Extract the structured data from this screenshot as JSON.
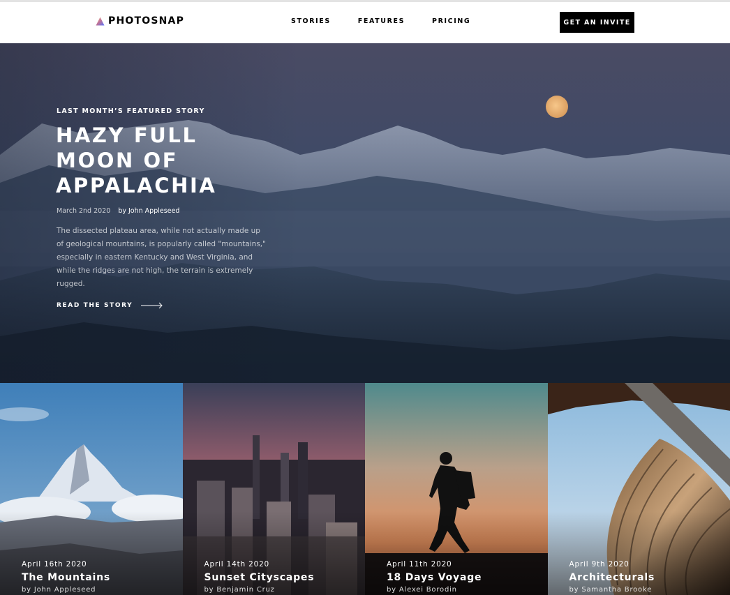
{
  "header": {
    "logo_text": "PHOTOSNAP",
    "nav": [
      "STORIES",
      "FEATURES",
      "PRICING"
    ],
    "cta_label": "GET AN INVITE"
  },
  "hero": {
    "eyebrow": "LAST MONTH’S FEATURED STORY",
    "title": "HAZY FULL MOON OF APPALACHIA",
    "date": "March 2nd 2020",
    "author": "by John Appleseed",
    "description": "The dissected plateau area, while not actually made up of geological mountains, is popularly called \"mountains,\" especially in eastern Kentucky and West Virginia, and while the ridges are not high, the terrain is extremely rugged.",
    "link_label": "READ THE STORY"
  },
  "cards": [
    {
      "date": "April 16th 2020",
      "title": "The Mountains",
      "author": "by John Appleseed"
    },
    {
      "date": "April 14th 2020",
      "title": "Sunset Cityscapes",
      "author": "by Benjamin Cruz"
    },
    {
      "date": "April 11th 2020",
      "title": "18 Days Voyage",
      "author": "by Alexei Borodin"
    },
    {
      "date": "April 9th 2020",
      "title": "Architecturals",
      "author": "by Samantha Brooke"
    }
  ],
  "colors": {
    "logo_gradient_start": "#ffc593",
    "logo_gradient_mid": "#bc7198",
    "logo_gradient_end": "#5a77ff",
    "button_bg": "#000000",
    "hero_bg": "#3a465e"
  }
}
